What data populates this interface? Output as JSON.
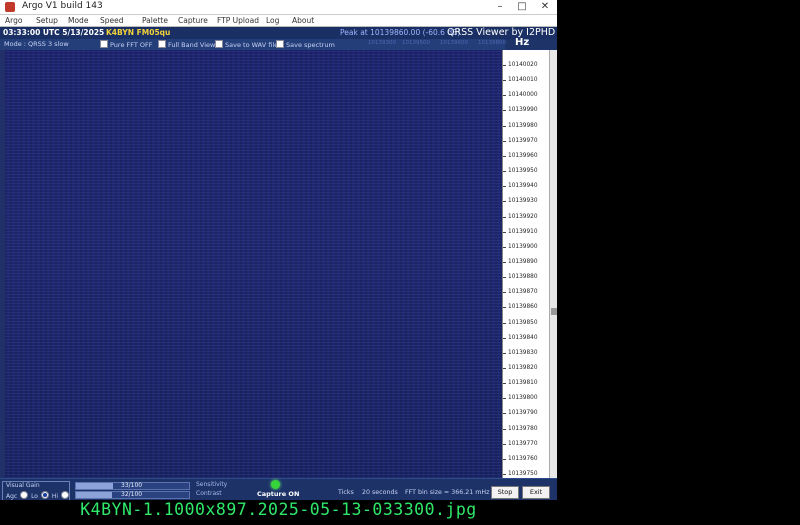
{
  "window": {
    "title": "Argo V1 build 143",
    "controls": {
      "minimize": "–",
      "maximize": "□",
      "close": "✕"
    }
  },
  "menu": [
    "Argo",
    "Setup",
    "Mode",
    "Speed",
    "Palette",
    "Capture",
    "FTP Upload",
    "Log",
    "About"
  ],
  "status": {
    "time": "03:33:00 UTC  5/13/2025",
    "callsign": "K4BYN FM05qu",
    "peak": "Peak at 10139860.00 (-60.6 dB)",
    "brand": "QRSS Viewer by I2PHD"
  },
  "options": {
    "mode": "Mode : QRSS 3 slow",
    "pure_fft": "Pure FFT OFF",
    "full_band": "Full Band View",
    "save_wav": "Save to WAV file",
    "save_spectrum": "Save spectrum"
  },
  "top_freq_ticks": [
    "10139300",
    "10139500",
    "10139600",
    "10139800"
  ],
  "axis": {
    "unit": "Hz",
    "labels": [
      "10140020",
      "10140010",
      "10140000",
      "10139990",
      "10139980",
      "10139970",
      "10139960",
      "10139950",
      "10139940",
      "10139930",
      "10139920",
      "10139910",
      "10139900",
      "10139890",
      "10139880",
      "10139870",
      "10139860",
      "10139850",
      "10139840",
      "10139830",
      "10139820",
      "10139810",
      "10139800",
      "10139790",
      "10139780",
      "10139770",
      "10139760",
      "10139750"
    ]
  },
  "controls": {
    "visual_gain": "Visual Gain",
    "agc": "Agc",
    "lo": "Lo",
    "hi": "Hi",
    "sensitivity_value": "33/100",
    "sensitivity_level": 0.33,
    "sensitivity_label": "Sensitivity",
    "contrast_value": "32/100",
    "contrast_level": 0.32,
    "contrast_label": "Contrast",
    "capture": "Capture ON",
    "ticks_label": "Ticks",
    "ticks_value": "20 seconds",
    "fft_bin": "FFT bin size = 366.21 mHz",
    "stop": "Stop",
    "exit": "Exit"
  },
  "colors": {
    "waterfall": "#1e2872",
    "window": "#1e3468",
    "capture_led": "#37d33a",
    "caption": "#2ee86a"
  },
  "caption": "K4BYN-1.1000x897.2025-05-13-033300.jpg"
}
